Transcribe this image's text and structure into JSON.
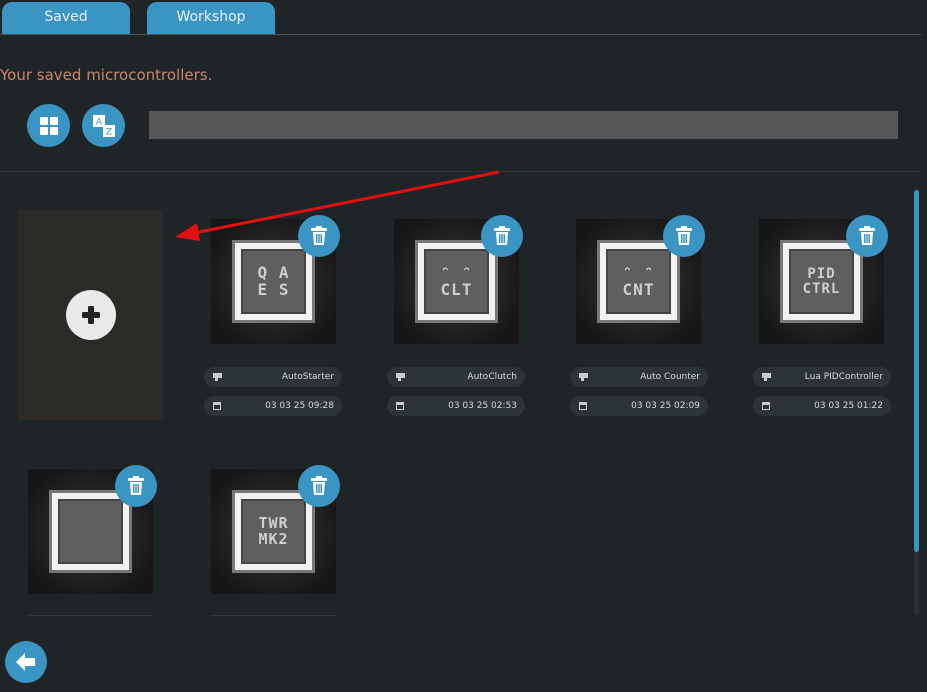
{
  "tabs": [
    {
      "label": "Saved"
    },
    {
      "label": "Workshop"
    }
  ],
  "subtitle": "Your saved microcontrollers.",
  "toolbar": {
    "grid_icon": "grid-icon",
    "sort_icon": "sort-az-icon",
    "search_value": ""
  },
  "cards": [
    {
      "name": "AutoStarter",
      "date": "03 03 25 09:28",
      "icon_lines": [
        "Q A",
        "E S"
      ]
    },
    {
      "name": "AutoClutch",
      "date": "03 03 25 02:53",
      "icon_lines": [
        "ᵔ ᵔ",
        "CLT"
      ]
    },
    {
      "name": "Auto Counter",
      "date": "03 03 25 02:09",
      "icon_lines": [
        "ᵔ ᵔ",
        "CNT"
      ]
    },
    {
      "name": "Lua PIDController",
      "date": "03 03 25 01:22",
      "icon_lines": [
        "PID",
        "CTRL"
      ]
    },
    {
      "name": "",
      "date": "",
      "icon_lines": [
        "",
        ""
      ]
    },
    {
      "name": "",
      "date": "",
      "icon_lines": [
        "TWR",
        "MK2"
      ]
    }
  ],
  "colors": {
    "accent": "#3a95c2",
    "subtitle": "#c9866d",
    "arrow": "#e01010"
  }
}
